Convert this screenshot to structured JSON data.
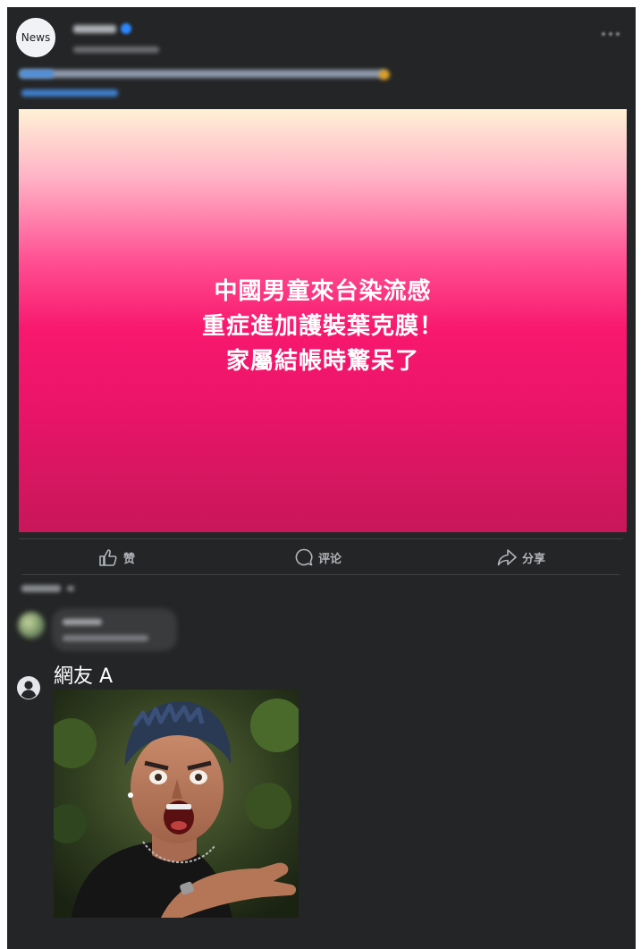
{
  "post": {
    "avatar_label": "News",
    "headline_lines": [
      "中國男童來台染流感",
      "重症進加護裝葉克膜！",
      "家屬結帳時驚呆了"
    ]
  },
  "actions": {
    "like_label": "赞",
    "comment_label": "评论",
    "share_label": "分享"
  },
  "comment": {
    "user_name": "網友 A"
  },
  "colors": {
    "background": "#242526",
    "hero_gradient_top": "#fff1d6",
    "hero_gradient_mid": "#f8186e",
    "hero_gradient_bottom": "#c8175a",
    "action_text": "#b0b3b8"
  }
}
